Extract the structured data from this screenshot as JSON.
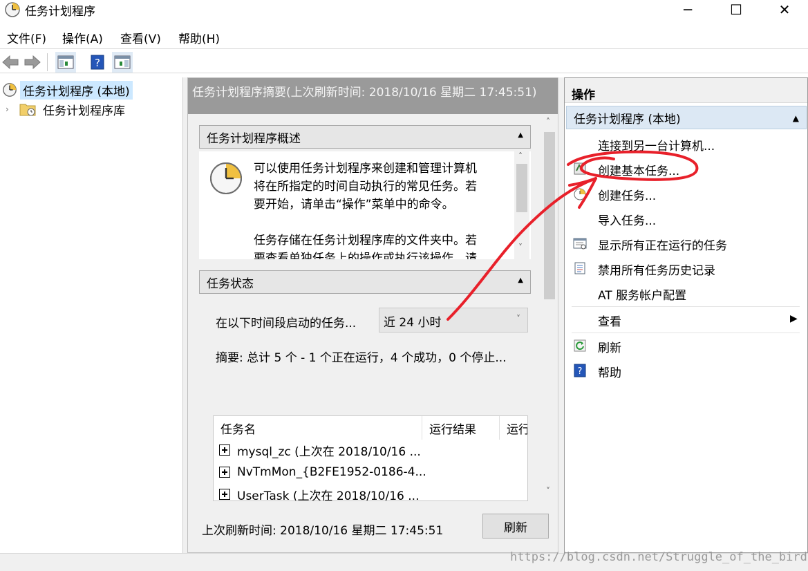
{
  "window": {
    "title": "任务计划程序",
    "controls": {
      "minimize": "─",
      "maximize": "☐",
      "close": "✕"
    }
  },
  "menu": [
    "文件(F)",
    "操作(A)",
    "查看(V)",
    "帮助(H)"
  ],
  "tree": {
    "root": "任务计划程序 (本地)",
    "child": "任务计划程序库"
  },
  "center": {
    "header": "任务计划程序摘要(上次刷新时间: 2018/10/16 星期二 17:45:51)",
    "overview_title": "任务计划程序概述",
    "overview_lines": [
      "可以使用任务计划程序来创建和管理计算机",
      "将在所指定的时间自动执行的常见任务。若",
      "要开始，请单击“操作”菜单中的命令。",
      "",
      "任务存储在任务计划程序库的文件夹中。若",
      "要查看单独任务上的操作或执行该操作，请"
    ],
    "status_title": "任务状态",
    "status_label": "在以下时间段启动的任务...",
    "period_value": "近 24 小时",
    "summary": "摘要: 总计 5 个 - 1 个正在运行，4 个成功，0 个停止...",
    "table": {
      "columns": [
        "任务名",
        "运行结果",
        "运行"
      ],
      "rows": [
        "mysql_zc (上次在 2018/10/16 ...",
        "NvTmMon_{B2FE1952-0186-4...",
        "UserTask (上次在 2018/10/16 ..."
      ]
    },
    "last_refresh": "上次刷新时间: 2018/10/16 星期二 17:45:51",
    "refresh_button": "刷新"
  },
  "actions": {
    "title": "操作",
    "group": "任务计划程序 (本地)",
    "items": [
      {
        "label": "连接到另一台计算机...",
        "icon": "none"
      },
      {
        "label": "创建基本任务...",
        "icon": "create-basic-task-icon"
      },
      {
        "label": "创建任务...",
        "icon": "create-task-icon"
      },
      {
        "label": "导入任务...",
        "icon": "none"
      },
      {
        "label": "显示所有正在运行的任务",
        "icon": "running-tasks-icon"
      },
      {
        "label": "禁用所有任务历史记录",
        "icon": "history-icon"
      },
      {
        "label": "AT 服务帐户配置",
        "icon": "none"
      },
      {
        "label": "查看",
        "icon": "none"
      },
      {
        "label": "刷新",
        "icon": "refresh-icon"
      },
      {
        "label": "帮助",
        "icon": "help-icon"
      }
    ]
  },
  "watermark": "https://blog.csdn.net/Struggle_of_the_bird",
  "colors": {
    "selection": "#cce8ff",
    "summary_header": "#9a9a9a",
    "actions_group": "#dce8f4",
    "annotation": "#e8202a"
  }
}
